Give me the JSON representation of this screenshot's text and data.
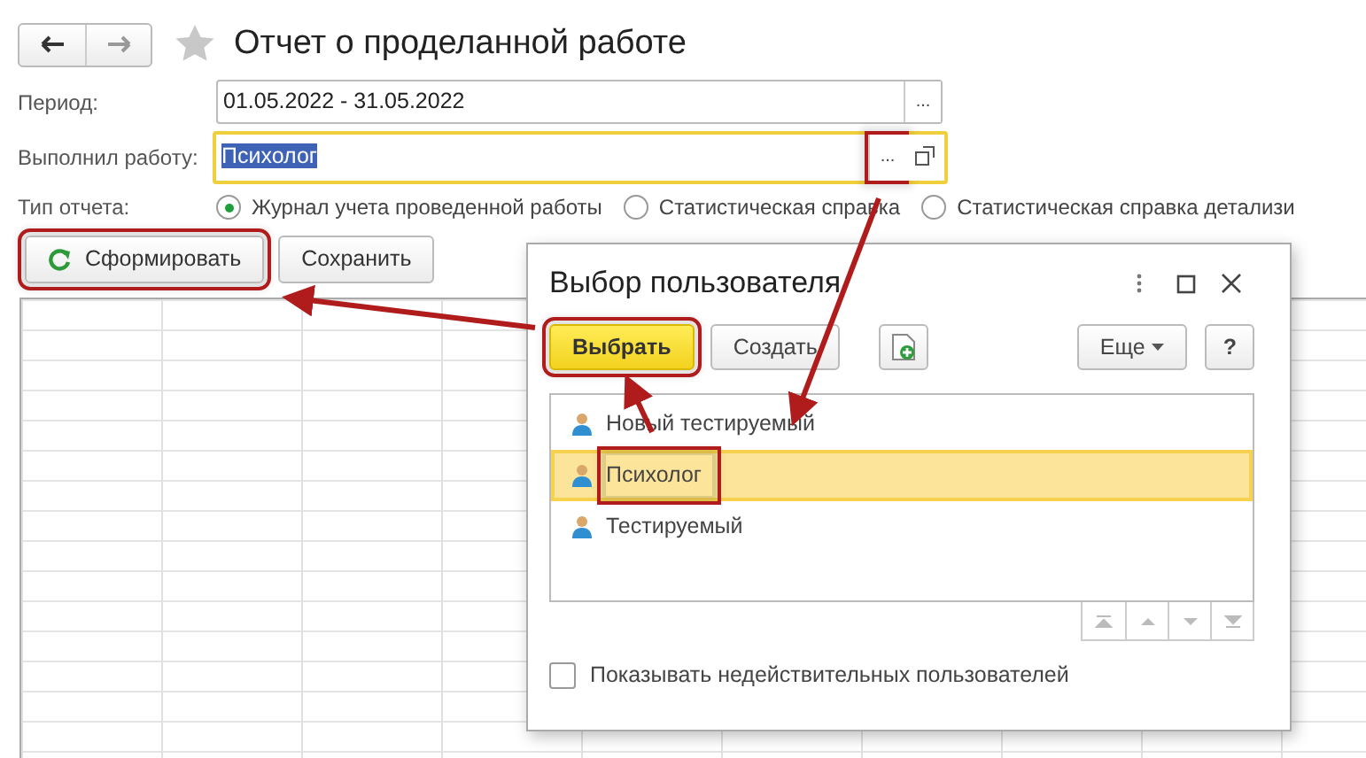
{
  "window": {
    "title": "Отчет о проделанной работе",
    "favorite": false
  },
  "fields": [
    {
      "label": "Период:",
      "value": "01.05.2022 - 31.05.2022",
      "focused": false,
      "value_selected": false,
      "choose_button": "...",
      "choose_highlighted": false
    },
    {
      "label": "Выполнил работу:",
      "value": "Психолог",
      "focused": true,
      "value_selected": true,
      "choose_button": "...",
      "choose_highlighted": true,
      "open_button": true
    }
  ],
  "report_type": {
    "label": "Тип отчета:",
    "options": [
      {
        "label": "Журнал учета проведенной работы",
        "selected": true
      },
      {
        "label": "Статистическая справка",
        "selected": false
      },
      {
        "label": "Статистическая справка детализи",
        "selected": false
      }
    ]
  },
  "toolbar": [
    {
      "label": "Сформировать",
      "kind": "refresh",
      "highlighted": true
    },
    {
      "label": "Сохранить",
      "kind": "plain",
      "highlighted": false
    }
  ],
  "dialog": {
    "title": "Выбор пользователя",
    "buttons": [
      {
        "label": "Выбрать",
        "kind": "default",
        "highlighted": true
      },
      {
        "label": "Создать",
        "kind": "plain",
        "highlighted": false
      },
      {
        "kind": "add-doc",
        "highlighted": false
      },
      {
        "label": "Еще",
        "kind": "menu",
        "highlighted": false
      },
      {
        "label": "?",
        "kind": "help",
        "highlighted": false
      }
    ],
    "users": [
      {
        "name": "Новый тестируемый",
        "selected": false,
        "highlighted": false
      },
      {
        "name": "Психолог",
        "selected": true,
        "highlighted": true
      },
      {
        "name": "Тестируемый",
        "selected": false,
        "highlighted": false
      }
    ],
    "show_invalid": {
      "label": "Показывать недействительных пользователей",
      "checked": false
    }
  }
}
